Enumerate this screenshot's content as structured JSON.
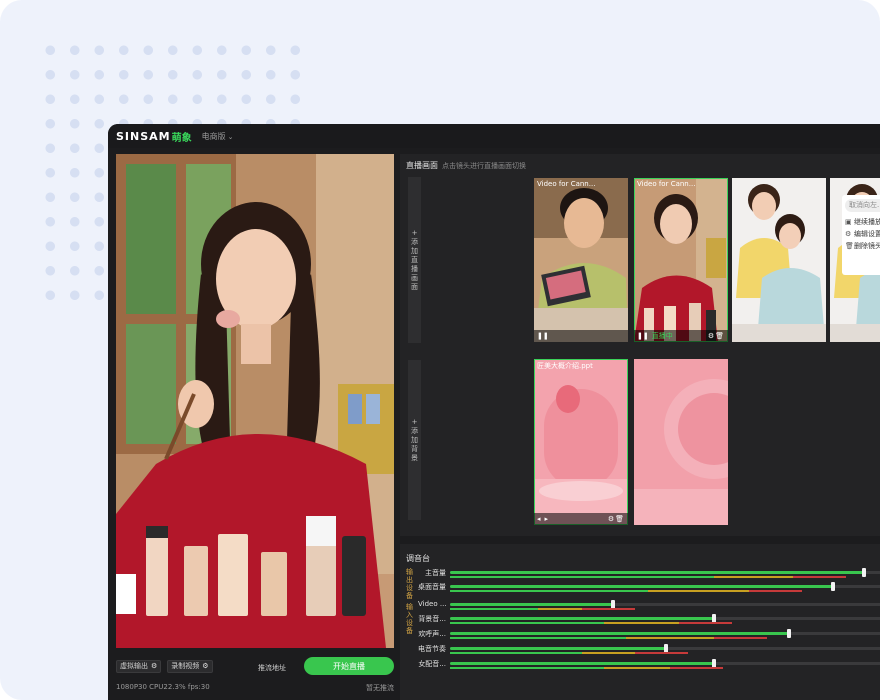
{
  "app": {
    "logo": "SINSAM",
    "logo_cn": "萌象",
    "edition": "电商版"
  },
  "preview": {
    "virtual_output": "虚拟输出",
    "record_video": "录制视频",
    "push_address": "推流地址",
    "start_live": "开始直播",
    "stats": "1080P30  CPU22.3% fps:30",
    "no_push": "暂无推流"
  },
  "scenes": {
    "title": "直播画面",
    "subtitle": "点击镜头进行直播画面切换",
    "add_scene": [
      "+",
      "添",
      "加",
      "直",
      "播",
      "画",
      "面"
    ],
    "add_background": [
      "+",
      "添",
      "加",
      "背",
      "景"
    ],
    "tiles": [
      {
        "label": "Video for Cann...",
        "status": "",
        "selected": false
      },
      {
        "label": "Video for Cann...",
        "status": "直播中",
        "selected": true
      },
      {
        "label": "",
        "status": "",
        "selected": false
      },
      {
        "label": "",
        "status": "",
        "selected": false
      }
    ],
    "bg_tiles": [
      {
        "label": "匠美大概介绍.ppt",
        "selected": true
      },
      {
        "label": "",
        "selected": false
      }
    ]
  },
  "context_menu": {
    "search": "取消向左...",
    "items": [
      "继续播放",
      "编辑设置",
      "删除镜头"
    ]
  },
  "mixer": {
    "title": "调音台",
    "output_group": [
      "输",
      "出",
      "设",
      "备"
    ],
    "input_group": [
      "输",
      "入",
      "设",
      "备"
    ],
    "rows": [
      {
        "name": "主音量",
        "level": 0.94,
        "meter": [
          0.6,
          0.78
        ]
      },
      {
        "name": "桌面音量",
        "level": 0.87,
        "meter": [
          0.45,
          0.68
        ]
      },
      {
        "name": "Video ...",
        "level": 0.37,
        "meter": [
          0.2,
          0.3
        ]
      },
      {
        "name": "背景音...",
        "level": 0.6,
        "meter": [
          0.35,
          0.52
        ]
      },
      {
        "name": "欢呼声...",
        "level": 0.77,
        "meter": [
          0.4,
          0.6
        ]
      },
      {
        "name": "电音节奏",
        "level": 0.49,
        "meter": [
          0.3,
          0.42
        ]
      },
      {
        "name": "女配音...",
        "level": 0.6,
        "meter": [
          0.35,
          0.5
        ]
      }
    ],
    "colors": {
      "green": "#39c64e",
      "amber": "#c8a021",
      "red": "#c63a3a"
    }
  }
}
